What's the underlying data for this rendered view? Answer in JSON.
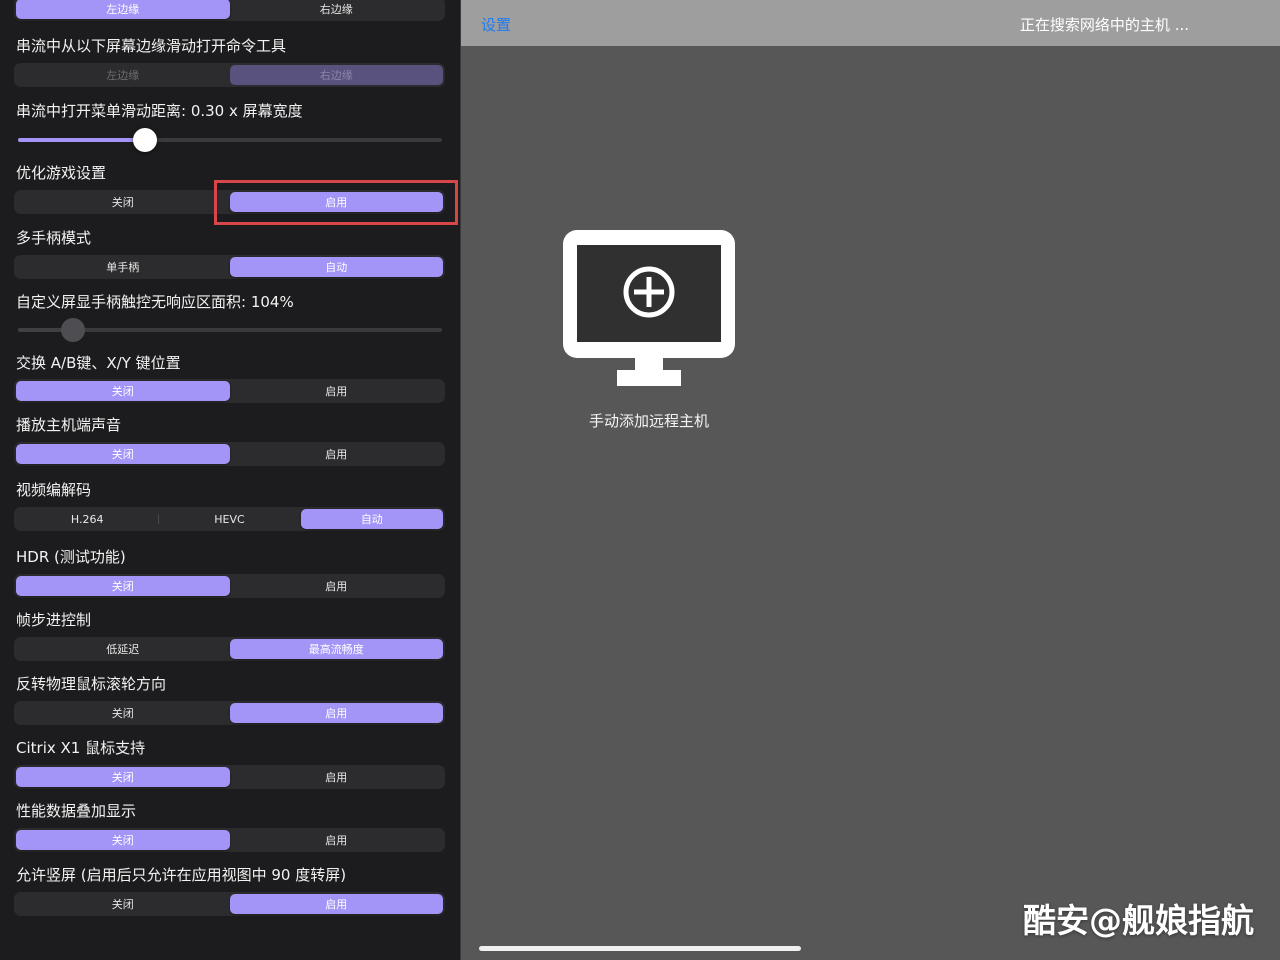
{
  "top_segment": {
    "options": [
      "左边缘",
      "右边缘"
    ],
    "selected": 0
  },
  "settings": [
    {
      "key": "command_tool_edge",
      "title": "串流中从以下屏幕边缘滑动打开命令工具",
      "options": [
        "左边缘",
        "右边缘"
      ],
      "selected": 1,
      "disabled": true
    },
    {
      "key": "menu_swipe_distance",
      "title": "串流中打开菜单滑动距离: 0.30 x 屏幕宽度",
      "slider_value": 0.3
    },
    {
      "key": "optimize_game",
      "title": "优化游戏设置",
      "options": [
        "关闭",
        "启用"
      ],
      "selected": 1
    },
    {
      "key": "multi_controller",
      "title": "多手柄模式",
      "options": [
        "单手柄",
        "自动"
      ],
      "selected": 1
    },
    {
      "key": "deadzone",
      "title": "自定义屏显手柄触控无响应区面积: 104%",
      "slider_value": 0.13,
      "disabled": true
    },
    {
      "key": "swap_ab_xy",
      "title": "交换 A/B键、X/Y 键位置",
      "options": [
        "关闭",
        "启用"
      ],
      "selected": 0
    },
    {
      "key": "host_audio",
      "title": "播放主机端声音",
      "options": [
        "关闭",
        "启用"
      ],
      "selected": 0
    },
    {
      "key": "video_codec",
      "title": "视频编解码",
      "options": [
        "H.264",
        "HEVC",
        "自动"
      ],
      "selected": 2
    },
    {
      "key": "hdr",
      "title": "HDR (测试功能)",
      "options": [
        "关闭",
        "启用"
      ],
      "selected": 0
    },
    {
      "key": "frame_pacing",
      "title": "帧步进控制",
      "options": [
        "低延迟",
        "最高流畅度"
      ],
      "selected": 1
    },
    {
      "key": "reverse_scroll",
      "title": "反转物理鼠标滚轮方向",
      "options": [
        "关闭",
        "启用"
      ],
      "selected": 1
    },
    {
      "key": "citrix_x1",
      "title": "Citrix X1 鼠标支持",
      "options": [
        "关闭",
        "启用"
      ],
      "selected": 0
    },
    {
      "key": "perf_overlay",
      "title": "性能数据叠加显示",
      "options": [
        "关闭",
        "启用"
      ],
      "selected": 0
    },
    {
      "key": "portrait",
      "title": "允许竖屏 (启用后只允许在应用视图中 90 度转屏)",
      "options": [
        "关闭",
        "启用"
      ],
      "selected": 1
    }
  ],
  "topbar": {
    "settings_link": "设置",
    "status": "正在搜索网络中的主机 ..."
  },
  "add_host": {
    "label": "手动添加远程主机",
    "icon": "monitor-plus-icon"
  },
  "watermark": "酷安@舰娘指航",
  "colors": {
    "accent": "#a395f7",
    "link": "#1e7cf2",
    "highlight": "#d9464a"
  }
}
